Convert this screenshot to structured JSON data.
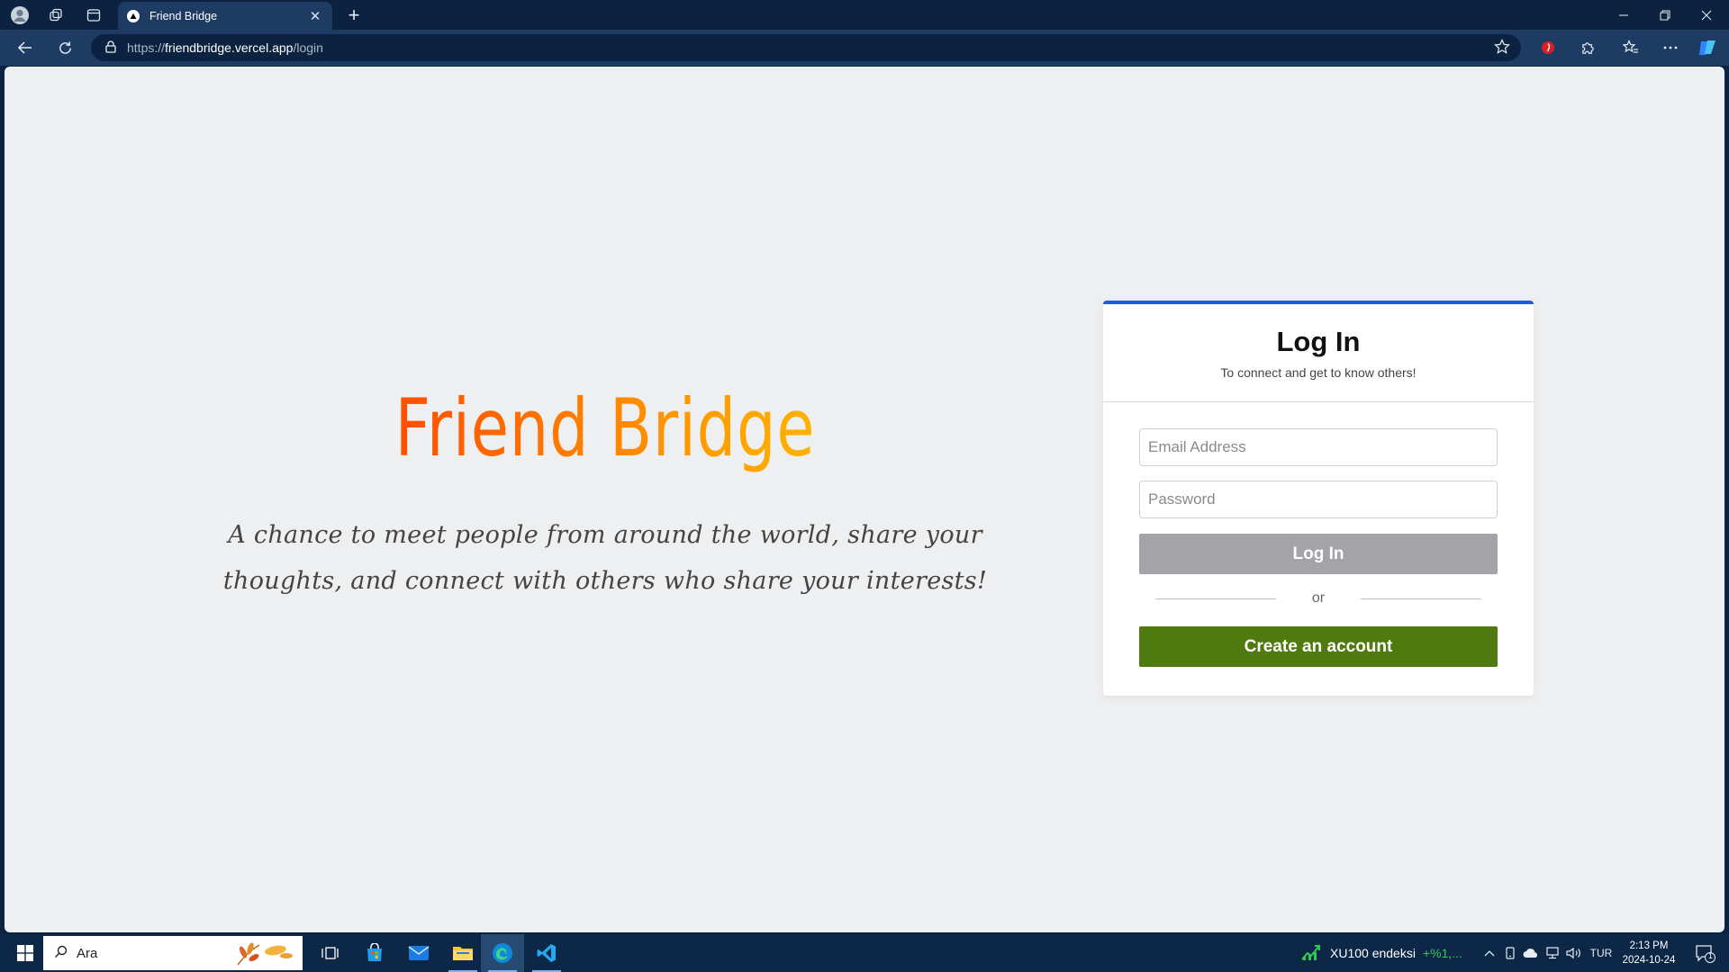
{
  "browser": {
    "tab_title": "Friend Bridge",
    "address": {
      "prefix": "https://",
      "domain": "friendbridge.vercel.app",
      "path": "/login"
    }
  },
  "page": {
    "brand": "Friend Bridge",
    "tagline": "A chance to meet people from around the world, share your thoughts, and connect with others who share your interests!",
    "login_card": {
      "title": "Log In",
      "subtitle": "To connect and get to know others!",
      "email_placeholder": "Email Address",
      "password_placeholder": "Password",
      "login_button": "Log In",
      "divider_text": "or",
      "create_button": "Create an account"
    }
  },
  "taskbar": {
    "search_placeholder": "Ara",
    "ticker_name": "XU100 endeksi",
    "ticker_change": "+%1,...",
    "language": "TUR",
    "time": "2:13 PM",
    "date": "2024-10-24",
    "notification_count": "1"
  },
  "colors": {
    "accent_blue": "#1e5bd8",
    "create_green": "#4f7a10",
    "login_disabled": "#a3a3a8",
    "brand_gradient": [
      "#ff4d00",
      "#ffb300"
    ]
  }
}
